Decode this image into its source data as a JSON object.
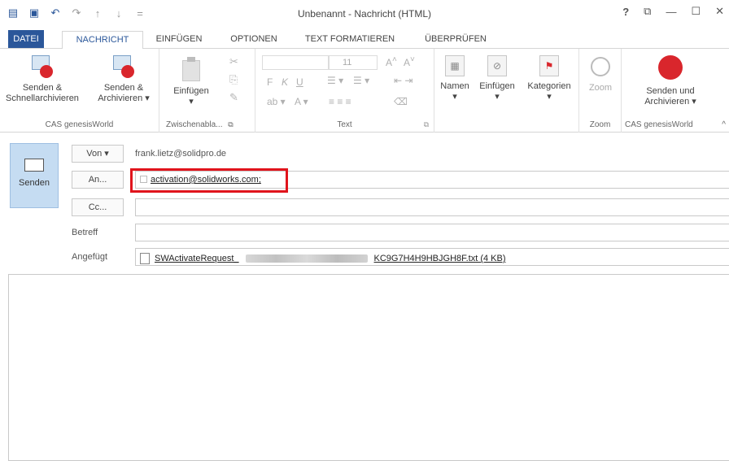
{
  "window": {
    "title": "Unbenannt - Nachricht (HTML)",
    "help": "?",
    "restore": "⧉",
    "minimize": "—",
    "maximize": "☐",
    "close": "✕"
  },
  "qat": {
    "app_icon": "outlook-icon",
    "save_icon": "save-icon",
    "undo_icon": "undo-icon",
    "redo_icon": "redo-icon",
    "up_icon": "up-arrow-icon",
    "down_icon": "down-arrow-icon",
    "customize_icon": "customize-icon"
  },
  "tabs": [
    "DATEI",
    "NACHRICHT",
    "EINFÜGEN",
    "OPTIONEN",
    "TEXT FORMATIEREN",
    "ÜBERPRÜFEN"
  ],
  "ribbon": {
    "cas1": {
      "btn1_line1": "Senden &",
      "btn1_line2": "Schnellarchivieren",
      "btn2_line1": "Senden &",
      "btn2_line2": "Archivieren ▾",
      "label": "CAS genesisWorld"
    },
    "clipboard": {
      "paste": "Einfügen",
      "paste_arrow": "▾",
      "label": "Zwischenabla...",
      "launcher": "⧉"
    },
    "text": {
      "font_size": "11",
      "bold": "F",
      "italic": "K",
      "underline": "U",
      "label": "Text",
      "launcher": "⧉"
    },
    "names": {
      "label": "Namen",
      "arrow": "▾"
    },
    "insert": {
      "label": "Einfügen",
      "arrow": "▾"
    },
    "categories": {
      "label": "Kategorien",
      "arrow": "▾"
    },
    "zoom": {
      "button": "Zoom",
      "label": "Zoom"
    },
    "cas2": {
      "line1": "Senden und",
      "line2": "Archivieren ▾",
      "label": "CAS genesisWorld",
      "collapse": "^"
    }
  },
  "compose": {
    "send": "Senden",
    "from_button": "Von ▾",
    "from_value": "frank.lietz@solidpro.de",
    "to_button": "An...",
    "to_value": "activation@solidworks.com;",
    "cc_button": "Cc...",
    "subject_label": "Betreff",
    "attached_label": "Angefügt",
    "attachment_prefix": "SWActivateRequest_",
    "attachment_suffix": "KC9G7H4H9HBJGH8F.txt (4 KB)"
  }
}
